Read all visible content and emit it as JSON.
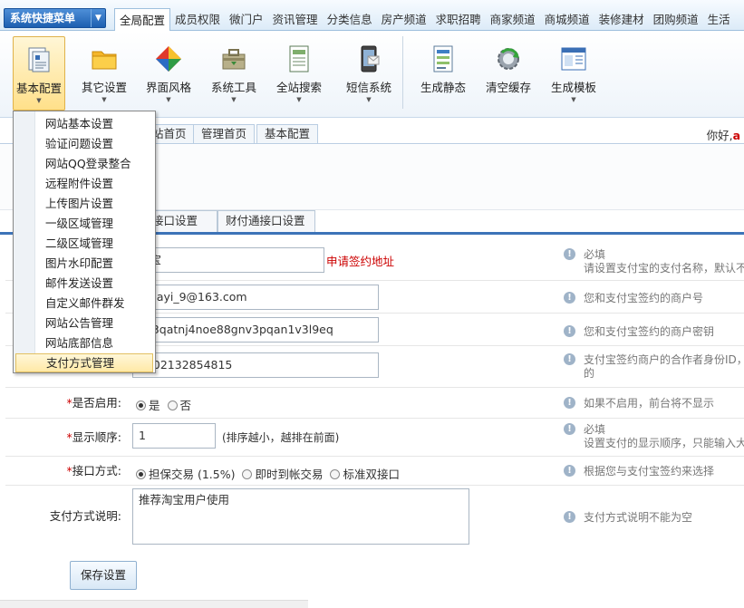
{
  "topnav": {
    "quick_menu": "系统快捷菜单",
    "tabs": [
      "全局配置",
      "成员权限",
      "微门户",
      "资讯管理",
      "分类信息",
      "房产频道",
      "求职招聘",
      "商家频道",
      "商城频道",
      "装修建材",
      "团购频道",
      "生活"
    ]
  },
  "toolbar": {
    "tools": [
      {
        "label": "基本配置",
        "icon": "basic-config-icon"
      },
      {
        "label": "其它设置",
        "icon": "folder-icon"
      },
      {
        "label": "界面风格",
        "icon": "palette-icon"
      },
      {
        "label": "系统工具",
        "icon": "toolbox-icon"
      },
      {
        "label": "全站搜索",
        "icon": "search-doc-icon"
      },
      {
        "label": "短信系统",
        "icon": "phone-sms-icon"
      },
      {
        "label": "生成静态",
        "icon": "generate-static-icon"
      },
      {
        "label": "清空缓存",
        "icon": "refresh-gear-icon"
      },
      {
        "label": "生成模板",
        "icon": "template-icon"
      }
    ]
  },
  "dropdown": {
    "items": [
      "网站基本设置",
      "验证问题设置",
      "网站QQ登录整合",
      "远程附件设置",
      "上传图片设置",
      "一级区域管理",
      "二级区域管理",
      "图片水印配置",
      "邮件发送设置",
      "自定义邮件群发",
      "网站公告管理",
      "网站底部信息",
      "支付方式管理"
    ],
    "selected": "支付方式管理"
  },
  "crumbs": {
    "items": [
      "站首页",
      "管理首页",
      "基本配置"
    ],
    "greeting": "你好,",
    "user": "a"
  },
  "iface_tabs": [
    "接口设置",
    "财付通接口设置"
  ],
  "form": {
    "name_value": "付宝",
    "sign_link": "申请签约地址",
    "name_help_1": "必填",
    "name_help_2": "请设置支付宝的支付名称，默认不",
    "account_value": "omayi_9@163.com",
    "account_help": "您和支付宝签约的商户号",
    "key_value": "c43qatnj4noe88gnv3pqan1v3l9eq",
    "key_help": "您和支付宝签约的商户密钥",
    "partner_value": "8502132854815",
    "partner_help_1": "支付宝签约商户的合作者身份ID，",
    "partner_help_2": "的",
    "enable_label": "是否启用:",
    "enable_yes": "是",
    "enable_no": "否",
    "enable_help": "如果不启用，前台将不显示",
    "order_label": "显示顺序:",
    "order_value": "1",
    "order_hint": "(排序越小，越排在前面)",
    "order_help_1": "必填",
    "order_help_2": "设置支付的显示顺序，只能输入大",
    "iface_label": "接口方式:",
    "iface_opt1": "担保交易 (1.5%)",
    "iface_opt2": "即时到帐交易",
    "iface_opt3": "标准双接口",
    "iface_help": "根据您与支付宝签约来选择",
    "desc_label": "支付方式说明:",
    "desc_value": "推荐淘宝用户使用",
    "desc_help": "支付方式说明不能为空",
    "save_label": "保存设置"
  }
}
